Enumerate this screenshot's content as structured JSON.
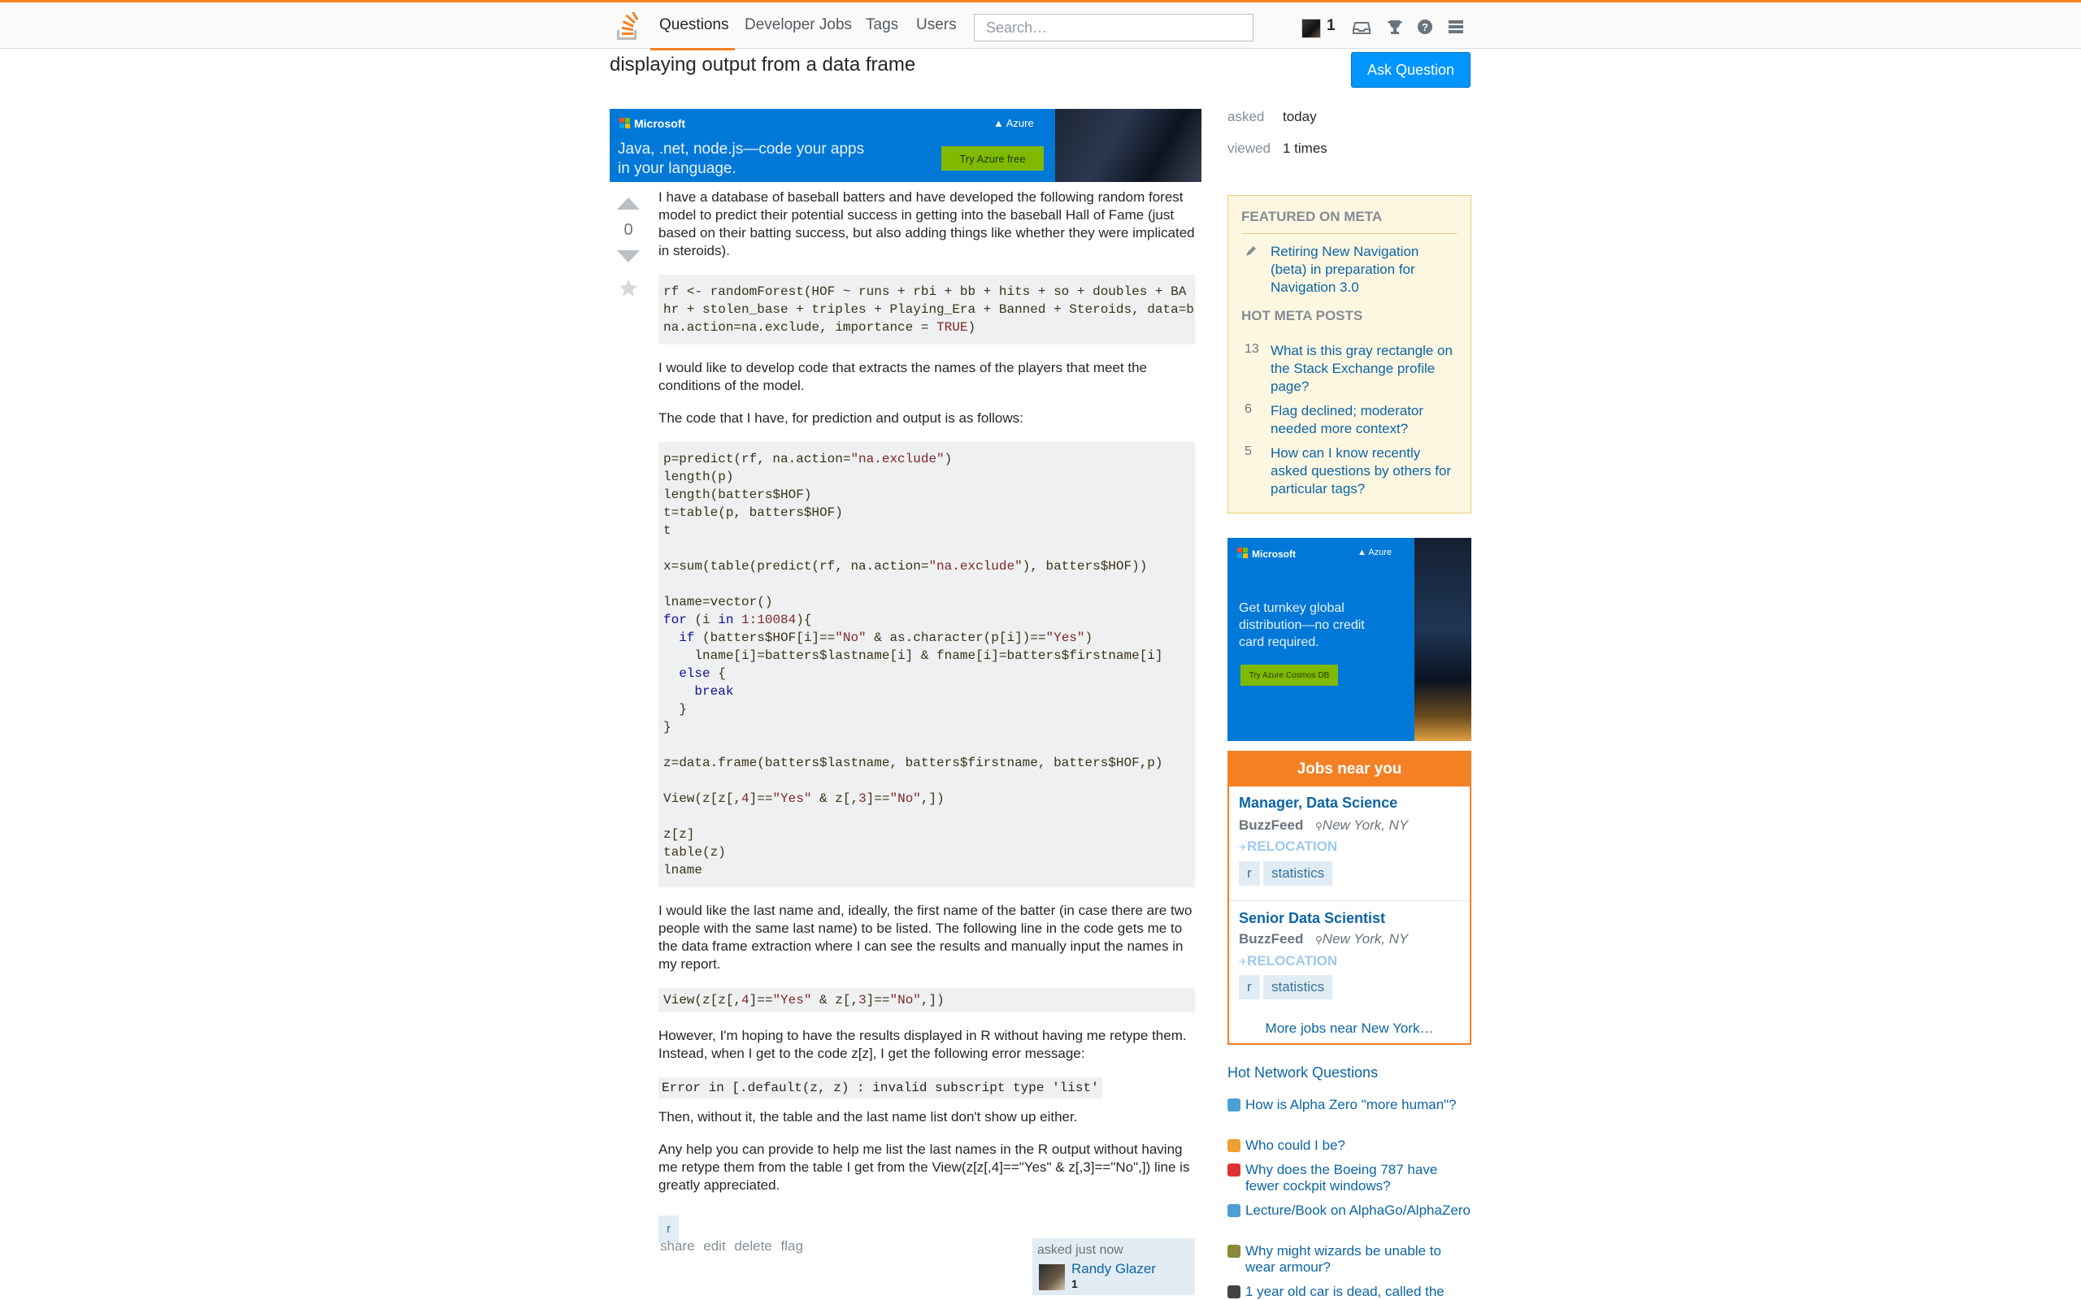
{
  "nav": {
    "questions": "Questions",
    "developer_jobs": "Developer Jobs",
    "tags": "Tags",
    "users": "Users",
    "search_placeholder": "Search…",
    "reputation": "1",
    "icons": [
      "inbox-icon",
      "achievements-icon",
      "help-icon",
      "site-switcher-icon"
    ],
    "accent_color": "#f48024"
  },
  "question": {
    "title": "displaying output from a data frame",
    "ask_button": "Ask Question",
    "votes": "0",
    "paragraphs": {
      "p1": "I have a database of baseball batters and have developed the following random forest model to predict their potential success in getting into the baseball Hall of Fame (just based on their batting success, but also adding things like whether they were implicated in steroids).",
      "p2": "I would like to develop code that extracts the names of the players that meet the conditions of the model.",
      "p3": "The code that I have, for prediction and output is as follows:",
      "p4": "I would like the last name and, ideally, the first name of the batter (in case there are two people with the same last name) to be listed. The following line in the code gets me to the data frame extraction where I can see the results and manually input the names in my report.",
      "p5": "However, I'm hoping to have the results displayed in R without having me retype them. Instead, when I get to the code z[z], I get the following error message:",
      "p6": "Then, without it, the table and the last name list don't show up either.",
      "p7": "Any help you can provide to help me list the last names in the R output without having me retype them from the table I get from the View(z[z[,4]==\"Yes\" & z[,3]==\"No\",]) line is greatly appreciated."
    },
    "error_code": "Error in [.default(z, z) : invalid subscript type 'list'",
    "tags": [
      "r"
    ],
    "menu": [
      "share",
      "edit",
      "delete",
      "flag"
    ],
    "owner": {
      "asked": "asked just now",
      "name": "Randy Glazer",
      "rep": "1"
    }
  },
  "stats": {
    "asked_label": "asked",
    "asked_value": "today",
    "viewed_label": "viewed",
    "viewed_value": "1 times"
  },
  "meta": {
    "featured_heading": "Featured on Meta",
    "featured": [
      {
        "text": "Retiring New Navigation (beta) in preparation for Navigation 3.0"
      }
    ],
    "hot_heading": "Hot Meta Posts",
    "hot": [
      {
        "score": "13",
        "text": "What is this gray rectangle on the Stack Exchange profile page?"
      },
      {
        "score": "6",
        "text": "Flag declined; moderator needed more context?"
      },
      {
        "score": "5",
        "text": "How can I know recently asked questions by others for particular tags?"
      }
    ]
  },
  "ads": {
    "top": {
      "brand": "Microsoft",
      "product": "Azure",
      "tagline": "Java, .net, node.js—code your apps in your language.",
      "cta": "Try Azure free"
    },
    "side": {
      "brand": "Microsoft",
      "product": "Azure",
      "tagline": "Get turnkey global distribution—no credit card required.",
      "cta": "Try Azure Cosmos DB"
    }
  },
  "jobs": {
    "heading": "Jobs near you",
    "items": [
      {
        "title": "Manager, Data Science",
        "company": "BuzzFeed",
        "location": "New York, NY",
        "perk": "Relocation",
        "tags": [
          "r",
          "statistics"
        ]
      },
      {
        "title": "Senior Data Scientist",
        "company": "BuzzFeed",
        "location": "New York, NY",
        "perk": "Relocation",
        "tags": [
          "r",
          "statistics"
        ]
      }
    ],
    "more": "More jobs near New York…"
  },
  "hnq": {
    "heading": "Hot Network Questions",
    "items": [
      {
        "text": "How is Alpha Zero \"more human\"?",
        "color": "#4b9fd5"
      },
      {
        "text": "Who could I be?",
        "color": "#f0a030"
      },
      {
        "text": "Why does the Boeing 787 have fewer cockpit windows?",
        "color": "#d33"
      },
      {
        "text": "Lecture/Book on AlphaGo/AlphaZero",
        "color": "#4b9fd5"
      },
      {
        "text": "Why might wizards be unable to wear armour?",
        "color": "#8a8a3a"
      },
      {
        "text": "1 year old car is dead, called the",
        "color": "#444"
      }
    ]
  }
}
